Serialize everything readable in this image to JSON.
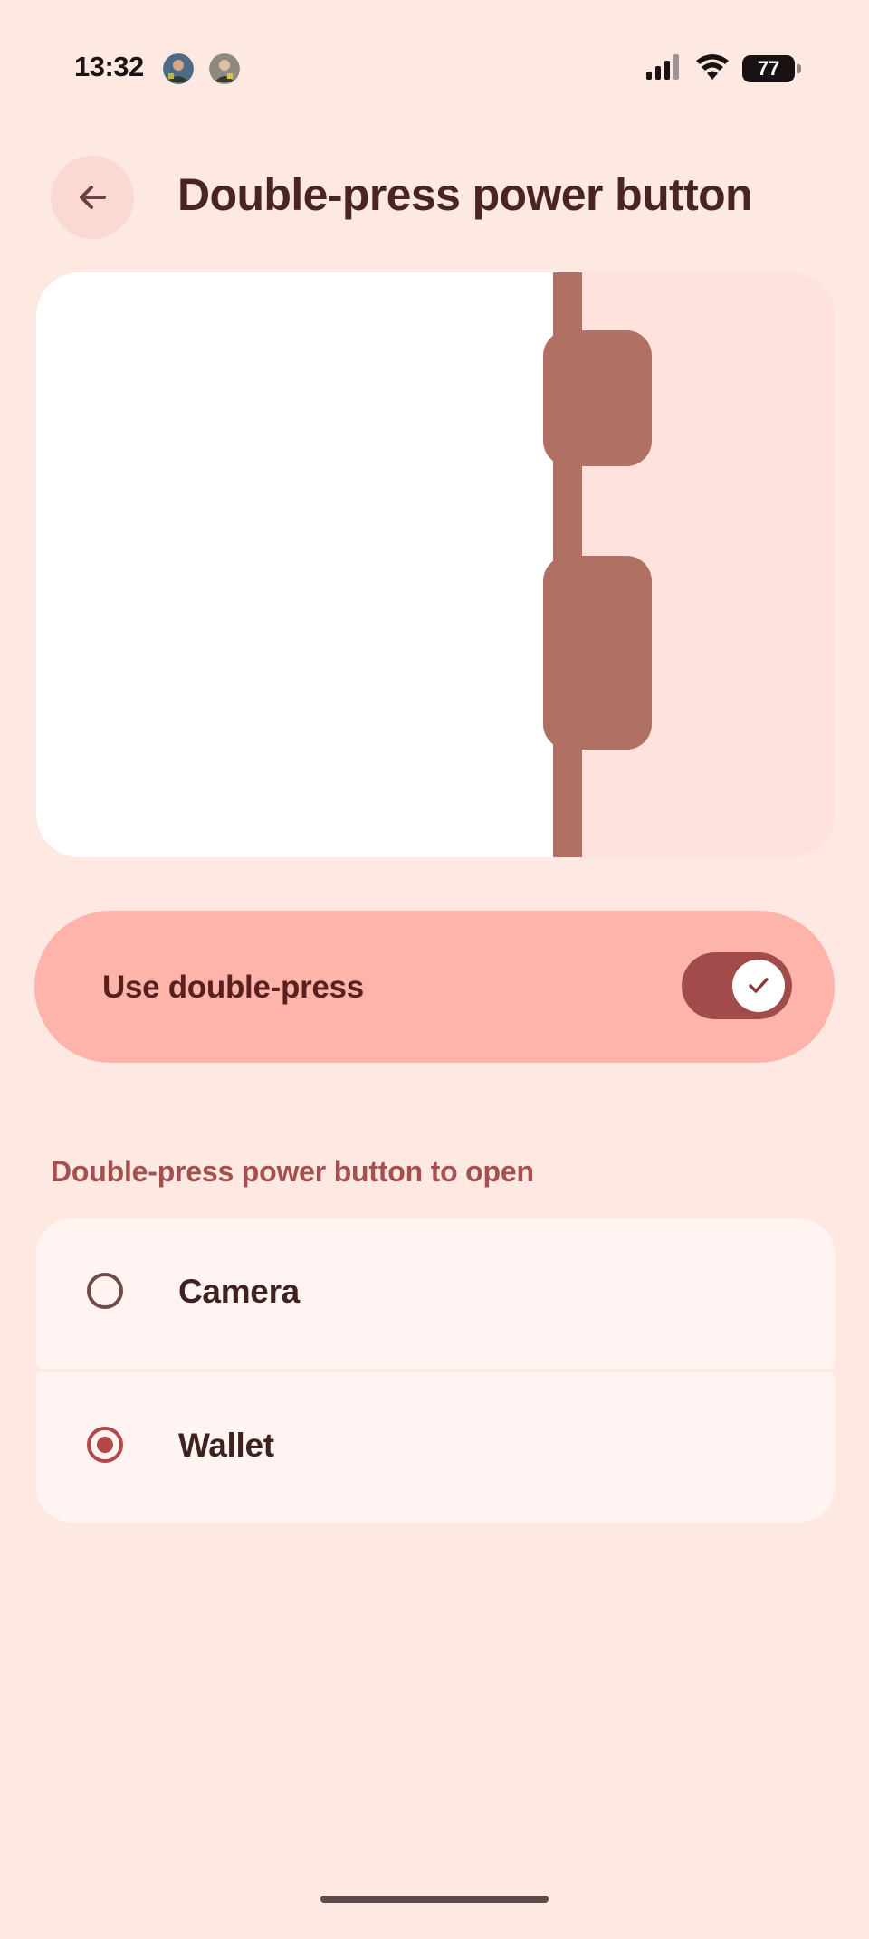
{
  "status_bar": {
    "time": "13:32",
    "battery_level": "77",
    "icons": [
      "avatar-1",
      "avatar-2",
      "signal-icon",
      "wifi-icon",
      "battery-icon"
    ]
  },
  "header": {
    "back_icon": "arrow-back-icon",
    "title": "Double-press power button"
  },
  "toggle": {
    "label": "Use double-press",
    "checked": true,
    "thumb_icon": "check-icon"
  },
  "options_section": {
    "title": "Double-press power button to open",
    "options": [
      {
        "label": "Camera",
        "selected": false
      },
      {
        "label": "Wallet",
        "selected": true
      }
    ]
  },
  "colors": {
    "background": "#fde8e2",
    "accent": "#a24b4b",
    "toggle_card": "#ffb4ab",
    "section_header": "#a45050",
    "option_card": "#fff4f1",
    "illustration_phone": "#b07063"
  }
}
